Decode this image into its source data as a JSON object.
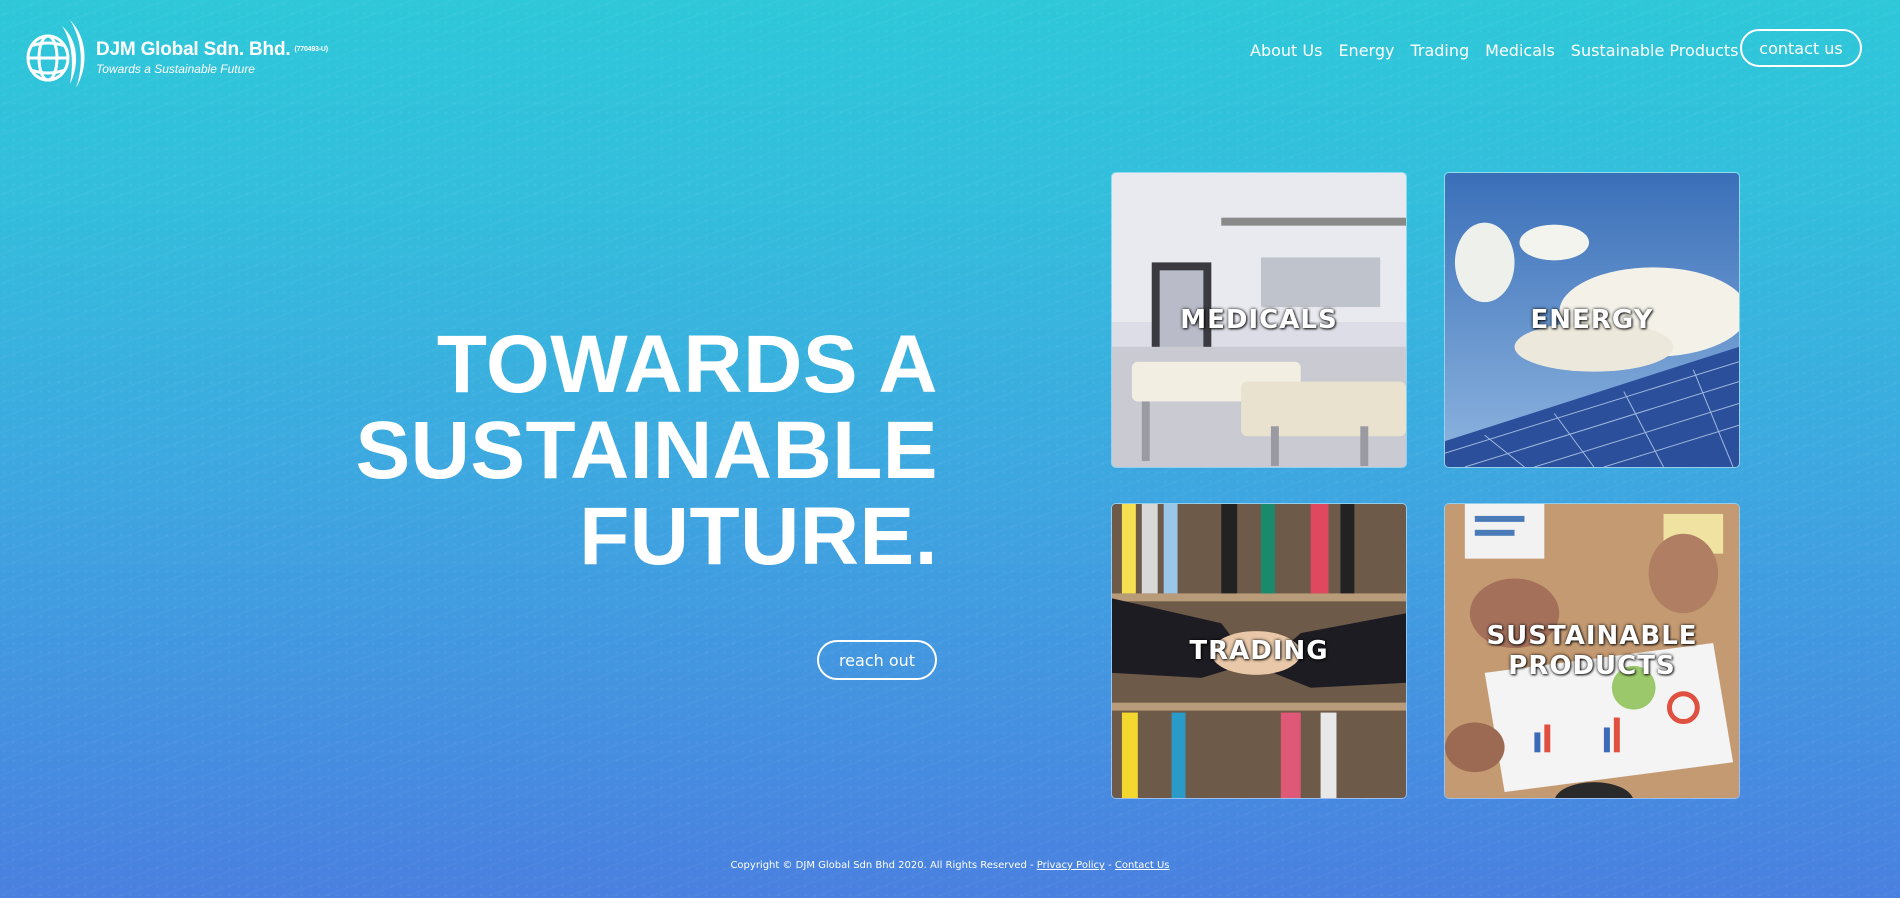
{
  "brand": {
    "name": "DJM Global Sdn. Bhd.",
    "registration": "(770493-U)",
    "tagline": "Towards a Sustainable Future"
  },
  "nav": {
    "items": [
      "About Us",
      "Energy",
      "Trading",
      "Medicals",
      "Sustainable Products"
    ],
    "contact_label": "contact us"
  },
  "hero": {
    "title_lines": [
      "TOWARDS A",
      "SUSTAINABLE",
      "FUTURE."
    ],
    "cta_label": "reach out"
  },
  "tiles": [
    {
      "label_lines": [
        "MEDICALS"
      ]
    },
    {
      "label_lines": [
        "ENERGY"
      ]
    },
    {
      "label_lines": [
        "TRADING"
      ]
    },
    {
      "label_lines": [
        "SUSTAINABLE",
        "PRODUCTS"
      ]
    }
  ],
  "footer": {
    "copyright": "Copyright © DJM Global Sdn Bhd 2020. All Rights Reserved -",
    "privacy_label": "Privacy Policy",
    "separator": "-",
    "contact_label": "Contact Us"
  },
  "colors": {
    "background_top": "#2ec8d9",
    "background_bottom": "#4a80e0",
    "text": "#ffffff"
  }
}
